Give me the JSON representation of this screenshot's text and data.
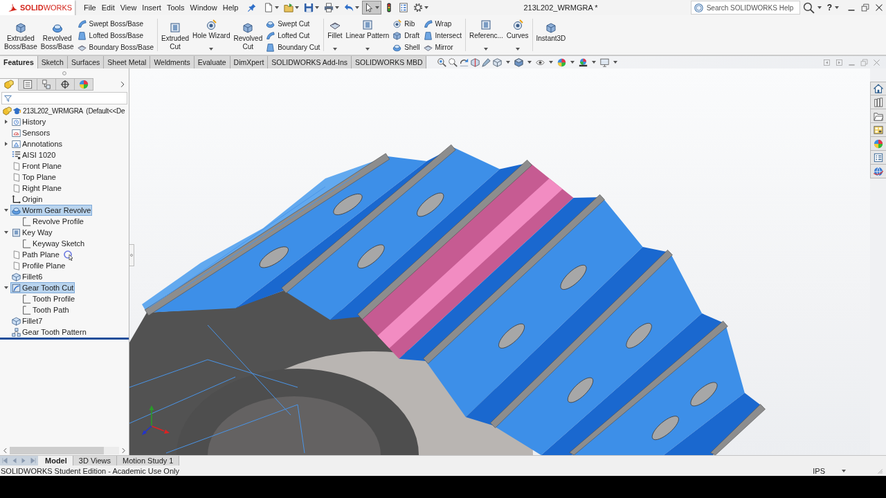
{
  "window": {
    "logo": "**SOLID**WORKS",
    "title": "213L202_WRMGRA *"
  },
  "menu": [
    "File",
    "Edit",
    "View",
    "Insert",
    "Tools",
    "Window",
    "Help"
  ],
  "quick_access": [
    {
      "kind": "new",
      "dropdown": true,
      "selected": false
    },
    {
      "kind": "open",
      "dropdown": true,
      "selected": false
    },
    {
      "kind": "save",
      "dropdown": true,
      "selected": false
    },
    {
      "kind": "print",
      "dropdown": true,
      "selected": false
    },
    {
      "kind": "undo",
      "dropdown": true,
      "selected": false
    },
    {
      "kind": "select",
      "dropdown": true,
      "selected": true
    },
    {
      "kind": "rebuild",
      "dropdown": false,
      "selected": false
    },
    {
      "kind": "properties",
      "dropdown": false,
      "selected": false
    },
    {
      "kind": "options",
      "dropdown": true,
      "selected": false
    }
  ],
  "search": {
    "placeholder": "Search SOLIDWORKS Help"
  },
  "help": "?",
  "command_groups": [
    {
      "items": [
        {
          "kind": "large",
          "label": "Extruded Boss/Base",
          "dropdown": false
        },
        {
          "kind": "large",
          "label": "Revolved Boss/Base",
          "dropdown": false
        },
        {
          "kind": "stack",
          "items": [
            {
              "label": "Swept Boss/Base"
            },
            {
              "label": "Lofted Boss/Base"
            },
            {
              "label": "Boundary Boss/Base"
            }
          ]
        }
      ]
    },
    {
      "items": [
        {
          "kind": "large",
          "label": "Extruded Cut",
          "dropdown": false
        },
        {
          "kind": "large",
          "label": "Hole Wizard",
          "dropdown": true
        },
        {
          "kind": "large",
          "label": "Revolved Cut",
          "dropdown": false
        },
        {
          "kind": "stack",
          "items": [
            {
              "label": "Swept Cut"
            },
            {
              "label": "Lofted Cut"
            },
            {
              "label": "Boundary Cut"
            }
          ]
        }
      ]
    },
    {
      "items": [
        {
          "kind": "large",
          "label": "Fillet",
          "dropdown": true
        },
        {
          "kind": "large",
          "label": "Linear Pattern",
          "dropdown": true
        },
        {
          "kind": "stack",
          "items": [
            {
              "label": "Rib"
            },
            {
              "label": "Draft"
            },
            {
              "label": "Shell"
            }
          ]
        },
        {
          "kind": "stack",
          "items": [
            {
              "label": "Wrap"
            },
            {
              "label": "Intersect"
            },
            {
              "label": "Mirror"
            }
          ]
        }
      ]
    },
    {
      "items": [
        {
          "kind": "large",
          "label": "Referenc...",
          "dropdown": true
        },
        {
          "kind": "large",
          "label": "Curves",
          "dropdown": true
        }
      ]
    },
    {
      "items": [
        {
          "kind": "large",
          "label": "Instant3D",
          "dropdown": false
        }
      ]
    }
  ],
  "tabs": [
    {
      "label": "Features",
      "selected": true
    },
    {
      "label": "Sketch",
      "selected": false
    },
    {
      "label": "Surfaces",
      "selected": false
    },
    {
      "label": "Sheet Metal",
      "selected": false
    },
    {
      "label": "Weldments",
      "selected": false
    },
    {
      "label": "Evaluate",
      "selected": false
    },
    {
      "label": "DimXpert",
      "selected": false
    },
    {
      "label": "SOLIDWORKS Add-Ins",
      "selected": false
    },
    {
      "label": "SOLIDWORKS MBD",
      "selected": false
    }
  ],
  "panel_tabs": [
    {
      "kind": "features",
      "selected": true
    },
    {
      "kind": "properties",
      "selected": false
    },
    {
      "kind": "configurations",
      "selected": false
    },
    {
      "kind": "dimxpert",
      "selected": false
    },
    {
      "kind": "display",
      "selected": false
    }
  ],
  "feature_tree": {
    "root": "213L202_WRMGRA  (Default<<De",
    "items": [
      {
        "label": "History",
        "kind": "history",
        "expanded": false,
        "selected": false
      },
      {
        "label": "Sensors",
        "kind": "sensors",
        "selected": false
      },
      {
        "label": "Annotations",
        "kind": "annotations",
        "expanded": false,
        "selected": false
      },
      {
        "label": "AISI 1020",
        "kind": "material",
        "selected": false
      },
      {
        "label": "Front Plane",
        "kind": "plane",
        "selected": false
      },
      {
        "label": "Top Plane",
        "kind": "plane",
        "selected": false
      },
      {
        "label": "Right Plane",
        "kind": "plane",
        "selected": false
      },
      {
        "label": "Origin",
        "kind": "origin",
        "selected": false
      },
      {
        "label": "Worm Gear Revolve",
        "kind": "revolve",
        "expanded": true,
        "selected": true,
        "children": [
          {
            "label": "Revolve Profile",
            "kind": "sketch",
            "selected": false
          }
        ]
      },
      {
        "label": "Key Way",
        "kind": "cut",
        "expanded": true,
        "selected": false,
        "children": [
          {
            "label": "Keyway Sketch",
            "kind": "sketch",
            "selected": false
          }
        ]
      },
      {
        "label": "Path Plane",
        "kind": "plane",
        "selected": false
      },
      {
        "label": "Profile Plane",
        "kind": "plane",
        "selected": false
      },
      {
        "label": "Fillet6",
        "kind": "fillet",
        "selected": false
      },
      {
        "label": "Gear Tooth Cut",
        "kind": "sweep",
        "expanded": true,
        "selected": true,
        "children": [
          {
            "label": "Tooth Profile",
            "kind": "sketch",
            "selected": false
          },
          {
            "label": "Tooth Path",
            "kind": "sketch",
            "selected": false
          }
        ]
      },
      {
        "label": "Fillet7",
        "kind": "fillet",
        "selected": false
      },
      {
        "label": "Gear Tooth Pattern",
        "kind": "pattern",
        "selected": false
      }
    ]
  },
  "model_tabs": [
    {
      "label": "Model",
      "selected": true
    },
    {
      "label": "3D Views",
      "selected": false
    },
    {
      "label": "Motion Study 1",
      "selected": false
    }
  ],
  "status_bar": {
    "message": "SOLIDWORKS Student Edition - Academic Use Only",
    "units": "IPS"
  }
}
